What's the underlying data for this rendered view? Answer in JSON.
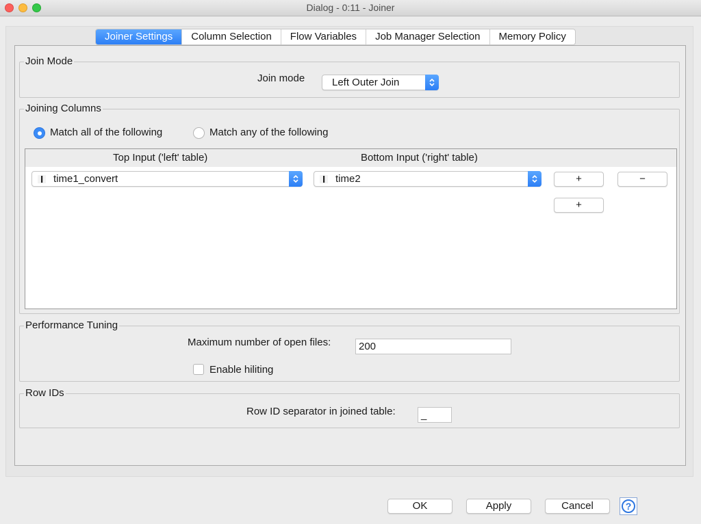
{
  "window": {
    "title": "Dialog - 0:11 - Joiner"
  },
  "tabs": [
    {
      "label": "Joiner Settings",
      "active": true
    },
    {
      "label": "Column Selection",
      "active": false
    },
    {
      "label": "Flow Variables",
      "active": false
    },
    {
      "label": "Job Manager Selection",
      "active": false
    },
    {
      "label": "Memory Policy",
      "active": false
    }
  ],
  "join_mode": {
    "legend": "Join Mode",
    "label": "Join mode",
    "value": "Left Outer Join"
  },
  "joining_columns": {
    "legend": "Joining Columns",
    "match_all_label": "Match all of the following",
    "match_any_label": "Match any of the following",
    "selected": "all",
    "left_header": "Top Input ('left' table)",
    "right_header": "Bottom Input ('right' table)",
    "rows": [
      {
        "left": "time1_convert",
        "right": "time2"
      }
    ],
    "add_label": "+",
    "remove_label": "−"
  },
  "performance": {
    "legend": "Performance Tuning",
    "max_files_label": "Maximum number of open files:",
    "max_files_value": "200",
    "hiliting_label": "Enable hiliting",
    "hiliting_checked": false
  },
  "row_ids": {
    "legend": "Row IDs",
    "separator_label": "Row ID separator in joined table:",
    "separator_value": "_"
  },
  "footer": {
    "ok": "OK",
    "apply": "Apply",
    "cancel": "Cancel",
    "help_icon": "?"
  },
  "colors": {
    "accent": "#2d7ff5",
    "close": "#fc605c",
    "minimize": "#fdbc40",
    "maximize": "#34c84a"
  }
}
